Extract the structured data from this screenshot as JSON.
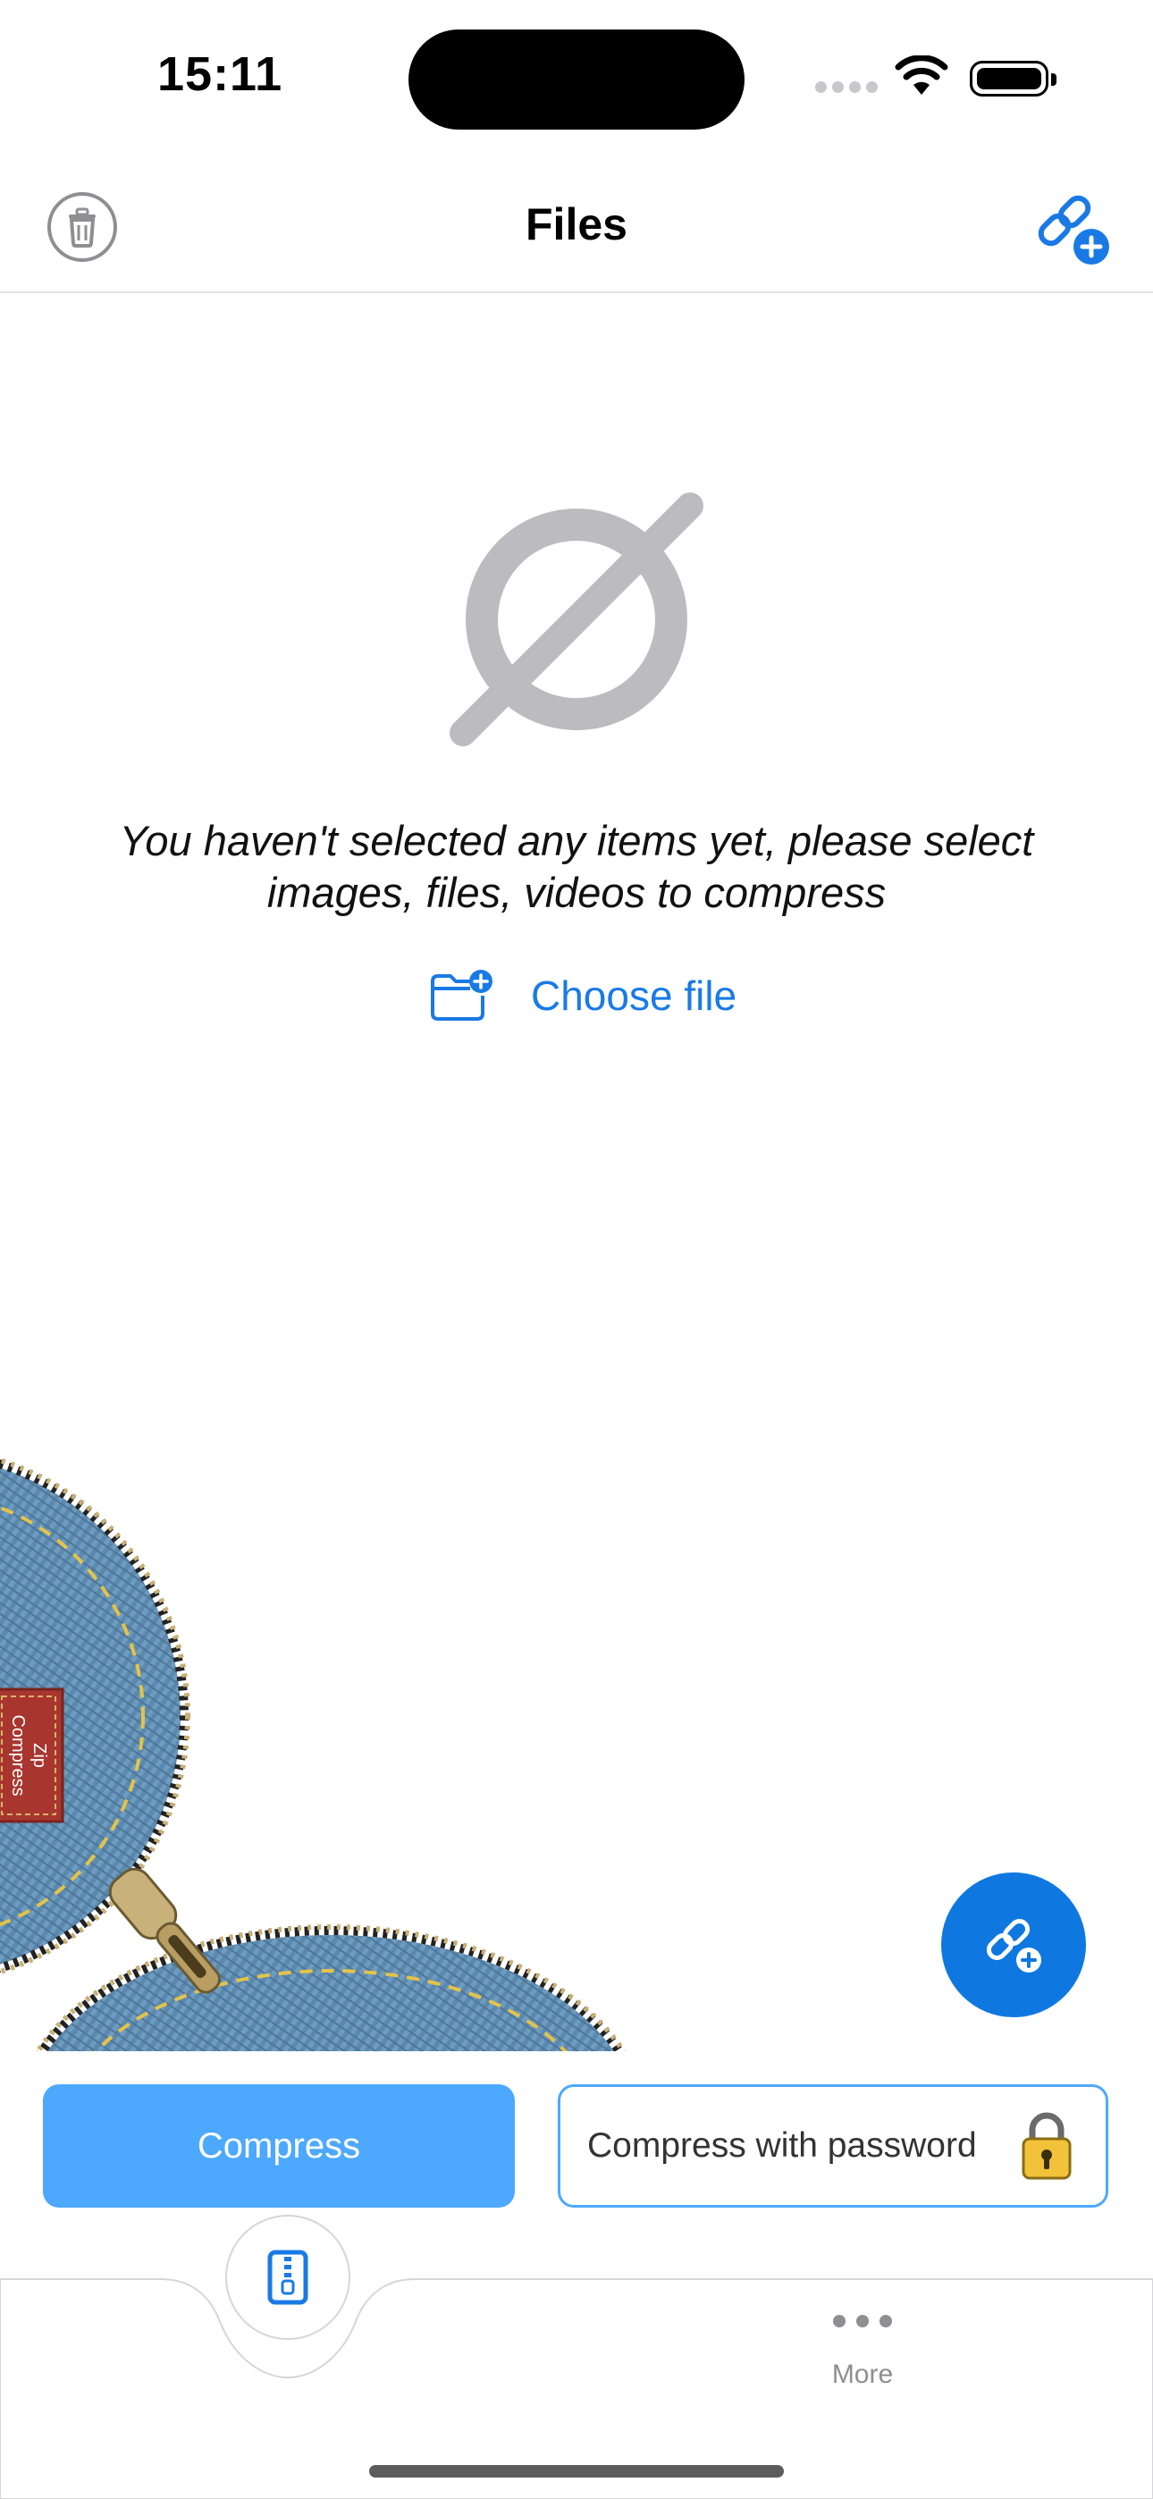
{
  "status_bar": {
    "time": "15:11"
  },
  "nav": {
    "title": "Files"
  },
  "empty_state": {
    "message": "You haven't selected any items yet, please select images, files, videos to compress",
    "choose_file_label": "Choose file"
  },
  "decoration": {
    "label_line1": "Zip",
    "label_line2": "Compress"
  },
  "actions": {
    "compress_label": "Compress",
    "compress_password_label": "Compress with password"
  },
  "tabbar": {
    "more_label": "More"
  },
  "colors": {
    "accent": "#1a7ae5",
    "button_fill": "#4da8ff",
    "fab": "#0f78e0",
    "muted": "#8e8e93"
  },
  "icons": [
    "trash-icon",
    "link-add-icon",
    "empty-set-icon",
    "folder-add-icon",
    "lock-icon",
    "zip-file-icon",
    "more-dots-icon"
  ]
}
